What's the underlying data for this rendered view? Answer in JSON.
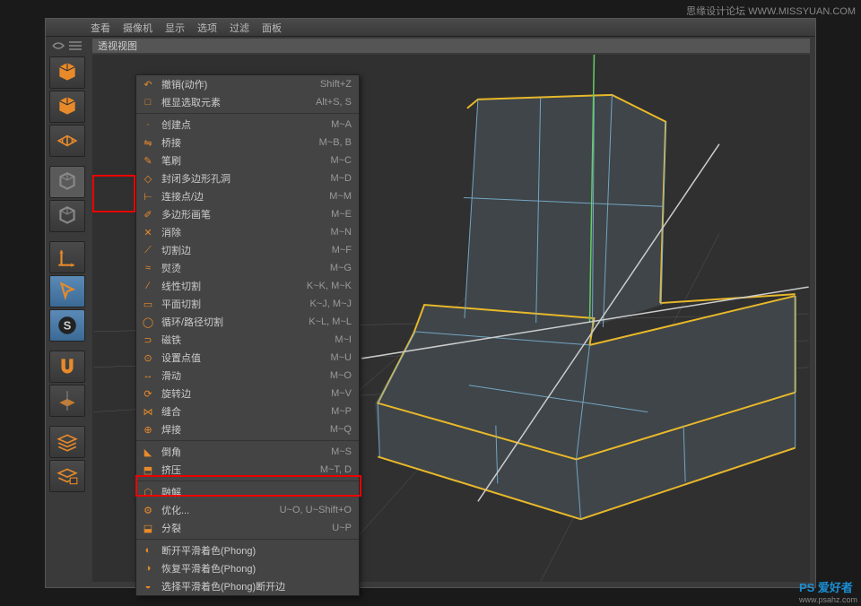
{
  "watermark_tr": "思缘设计论坛 WWW.MISSYUAN.COM",
  "watermark_br": "PS 爱好者",
  "watermark_br_sub": "www.psahz.com",
  "topmenu": {
    "items": [
      "查看",
      "摄像机",
      "显示",
      "选项",
      "过滤",
      "面板"
    ]
  },
  "viewport_label": "透视视图",
  "tools": [
    {
      "name": "cube-tool",
      "svg": "cube",
      "fill": "#e88a2a"
    },
    {
      "name": "cube-alt-tool",
      "svg": "cube",
      "fill": "#e88a2a"
    },
    {
      "name": "grid-tool",
      "svg": "grid",
      "fill": "#e88a2a"
    },
    {
      "name": "sep"
    },
    {
      "name": "editable-tool",
      "svg": "cube-line",
      "fill": "#888",
      "active": true
    },
    {
      "name": "model-tool",
      "svg": "cube-line",
      "fill": "#888"
    },
    {
      "name": "sep"
    },
    {
      "name": "axis-tool",
      "svg": "axis",
      "fill": "#e88a2a"
    },
    {
      "name": "move-tool",
      "svg": "cursor",
      "fill": "#e88a2a",
      "on": true
    },
    {
      "name": "snap-tool",
      "svg": "s",
      "fill": "#444",
      "on": true
    },
    {
      "name": "sep"
    },
    {
      "name": "magnet-tool",
      "svg": "magnet",
      "fill": "#e88a2a"
    },
    {
      "name": "workplane-tool",
      "svg": "plane",
      "fill": "#e88a2a"
    },
    {
      "name": "sep"
    },
    {
      "name": "layer-tool",
      "svg": "layers",
      "fill": "#e88a2a"
    },
    {
      "name": "lock-layer-tool",
      "svg": "layers-lock",
      "fill": "#e88a2a"
    }
  ],
  "menu": [
    {
      "ico": "undo",
      "label": "撤销(动作)",
      "shortcut": "Shift+Z"
    },
    {
      "ico": "frame",
      "label": "框显选取元素",
      "shortcut": "Alt+S, S"
    },
    {
      "div": true
    },
    {
      "ico": "pt",
      "label": "创建点",
      "shortcut": "M~A"
    },
    {
      "ico": "bridge",
      "label": "桥接",
      "shortcut": "M~B, B"
    },
    {
      "ico": "brush",
      "label": "笔刷",
      "shortcut": "M~C"
    },
    {
      "ico": "close",
      "label": "封闭多边形孔洞",
      "shortcut": "M~D"
    },
    {
      "ico": "edge",
      "label": "连接点/边",
      "shortcut": "M~M"
    },
    {
      "ico": "pen",
      "label": "多边形画笔",
      "shortcut": "M~E"
    },
    {
      "ico": "elim",
      "label": "消除",
      "shortcut": "M~N"
    },
    {
      "ico": "cut",
      "label": "切割边",
      "shortcut": "M~F"
    },
    {
      "ico": "iron",
      "label": "熨烫",
      "shortcut": "M~G"
    },
    {
      "ico": "kcut",
      "label": "线性切割",
      "shortcut": "K~K, M~K"
    },
    {
      "ico": "pcut",
      "label": "平面切割",
      "shortcut": "K~J, M~J"
    },
    {
      "ico": "loop",
      "label": "循环/路径切割",
      "shortcut": "K~L, M~L"
    },
    {
      "ico": "mag",
      "label": "磁铁",
      "shortcut": "M~I"
    },
    {
      "ico": "set",
      "label": "设置点值",
      "shortcut": "M~U"
    },
    {
      "ico": "slide",
      "label": "滑动",
      "shortcut": "M~O"
    },
    {
      "ico": "spin",
      "label": "旋转边",
      "shortcut": "M~V"
    },
    {
      "ico": "stitch",
      "label": "缝合",
      "shortcut": "M~P"
    },
    {
      "ico": "weld",
      "label": "焊接",
      "shortcut": "M~Q"
    },
    {
      "div": true
    },
    {
      "ico": "bevel",
      "label": "倒角",
      "shortcut": "M~S"
    },
    {
      "ico": "extr",
      "label": "挤压",
      "shortcut": "M~T, D"
    },
    {
      "div": true
    },
    {
      "ico": "dis",
      "label": "融解",
      "shortcut": ""
    },
    {
      "ico": "opt",
      "label": "优化...",
      "shortcut": "U~O, U~Shift+O"
    },
    {
      "ico": "split",
      "label": "分裂",
      "shortcut": "U~P"
    },
    {
      "div": true
    },
    {
      "ico": "ph1",
      "label": "断开平滑着色(Phong)",
      "shortcut": ""
    },
    {
      "ico": "ph2",
      "label": "恢复平滑着色(Phong)",
      "shortcut": ""
    },
    {
      "ico": "ph3",
      "label": "选择平滑着色(Phong)断开边",
      "shortcut": ""
    }
  ]
}
